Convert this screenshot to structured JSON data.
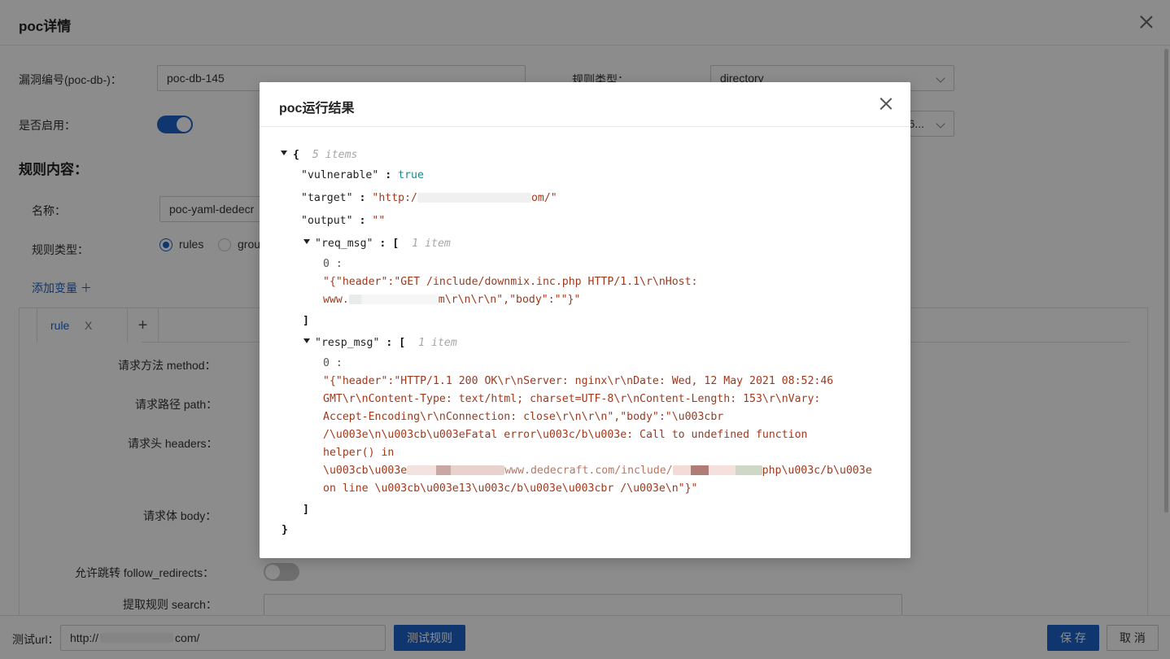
{
  "page": {
    "title": "poc详情",
    "vuln_id_label": "漏洞编号(poc-db-)：",
    "vuln_id_value": "poc-db-145",
    "rule_type_label": "规则类型：",
    "rule_type_value": "directory",
    "enabled_label": "是否启用：",
    "second_select_value": "-6...",
    "rule_content_title": "规则内容：",
    "name_label": "名称：",
    "name_value": "poc-yaml-dedecr",
    "rule_kind_label": "规则类型：",
    "radio_rules": "rules",
    "radio_groups": "grou",
    "add_variable": "添加变量 ＋",
    "tab_rule": "rule",
    "tab_close": "X",
    "tab_add": "+",
    "method_label": "请求方法 method：",
    "path_label": "请求路径 path：",
    "headers_label": "请求头 headers：",
    "body_label": "请求体 body：",
    "follow_label": "允许跳转 follow_redirects：",
    "search_label": "提取规则 search：",
    "test_url_label": "测试url：",
    "test_url_value_a": "http://",
    "test_url_value_b": "com/",
    "test_button": "测试规则",
    "save_button": "保 存",
    "cancel_button": "取 消"
  },
  "modal": {
    "title": "poc运行结果",
    "root_open": "{",
    "root_meta": "5 items",
    "root_close": "}",
    "key_vulnerable": "\"vulnerable\"",
    "val_vulnerable": "true",
    "key_target": "\"target\"",
    "val_target_a": "\"http:/",
    "val_target_b": "om/\"",
    "key_output": "\"output\"",
    "val_output": "\"\"",
    "key_req": "\"req_msg\"",
    "req_open": "[",
    "req_meta": "1 item",
    "req_index": "0 :",
    "req_line1": "\"{\"header\":\"GET /include/downmix.inc.php HTTP/1.1\\r\\nHost:",
    "req_line2_a": "www.",
    "req_line2_b": "m\\r\\n\\r\\n\",\"body\":\"\"}\"",
    "req_close": "]",
    "key_resp": "\"resp_msg\"",
    "resp_open": "[",
    "resp_meta": "1 item",
    "resp_index": "0 :",
    "resp_line1": "\"{\"header\":\"HTTP/1.1 200 OK\\r\\nServer: nginx\\r\\nDate: Wed, 12 May 2021 08:52:46",
    "resp_line2": "GMT\\r\\nContent-Type: text/html; charset=UTF-8\\r\\nContent-Length: 153\\r\\nVary:",
    "resp_line3": "Accept-Encoding\\r\\nConnection: close\\r\\n\\r\\n\",\"body\":\"\\u003cbr",
    "resp_line4": "/\\u003e\\n\\u003cb\\u003eFatal error\\u003c/b\\u003e: Call to undefined function",
    "resp_line5": "helper() in",
    "resp_line6_a": "\\u003cb\\u003e",
    "resp_line6_b": "www.dedecraft.com/include/",
    "resp_line6_c": "php\\u003c/b\\u003e",
    "resp_line7": "on line \\u003cb\\u003e13\\u003c/b\\u003e\\u003cbr /\\u003e\\n\"}\"",
    "resp_close": "]"
  },
  "colors": {
    "primary": "#1d63c9",
    "json_string": "#a0391c",
    "json_bool": "#1b8a8a"
  }
}
